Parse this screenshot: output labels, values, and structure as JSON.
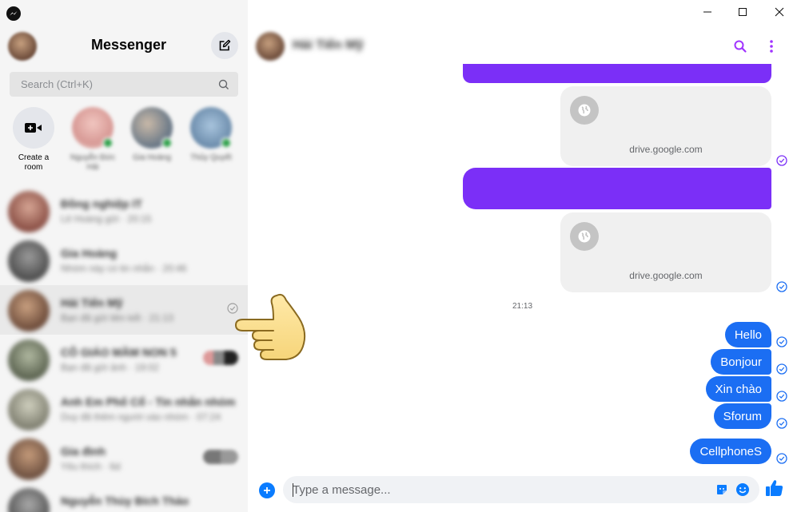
{
  "sidebar": {
    "title": "Messenger",
    "search_placeholder": "Search (Ctrl+K)",
    "stories": [
      {
        "label": "Create a room"
      },
      {
        "label": "Nguyễn Đức Hải"
      },
      {
        "label": "Gia Hoàng"
      },
      {
        "label": "Thủy Quyết"
      }
    ],
    "conversations": [
      {
        "name": "Đồng nghiệp IT",
        "sub": "Lê Hoàng gửi · 20:15"
      },
      {
        "name": "Gia Hoàng",
        "sub": "Nhóm này có tin nhắn · 20:46"
      },
      {
        "name": "Hải Tiến Mỹ",
        "sub": "Bạn đã gửi liên kết · 21:13"
      },
      {
        "name": "CÔ GIÁO MẦM NON 5",
        "sub": "Bạn đã gửi ảnh · 19:02"
      },
      {
        "name": "Anh Em Phố Cổ - Tin nhắn nhóm",
        "sub": "Duy đã thêm người vào nhóm · 07:24"
      },
      {
        "name": "Gia đình",
        "sub": "Yêu thích · 6d"
      },
      {
        "name": "Nguyễn Thùy Bích Thảo",
        "sub": ""
      }
    ]
  },
  "chat": {
    "name": "Hải Tiến Mỹ",
    "link_domain_1": "drive.google.com",
    "link_domain_2": "drive.google.com",
    "timestamp": "21:13",
    "messages": [
      "Hello",
      "Bonjour",
      "Xin chào",
      "Sforum",
      "CellphoneS"
    ],
    "input_placeholder": "Type a message..."
  },
  "colors": {
    "accent": "#0a7cff",
    "outgoing_bubble": "#1b6ef3",
    "purple_bubble": "#7b2ff7",
    "header_icon": "#a033ff"
  }
}
